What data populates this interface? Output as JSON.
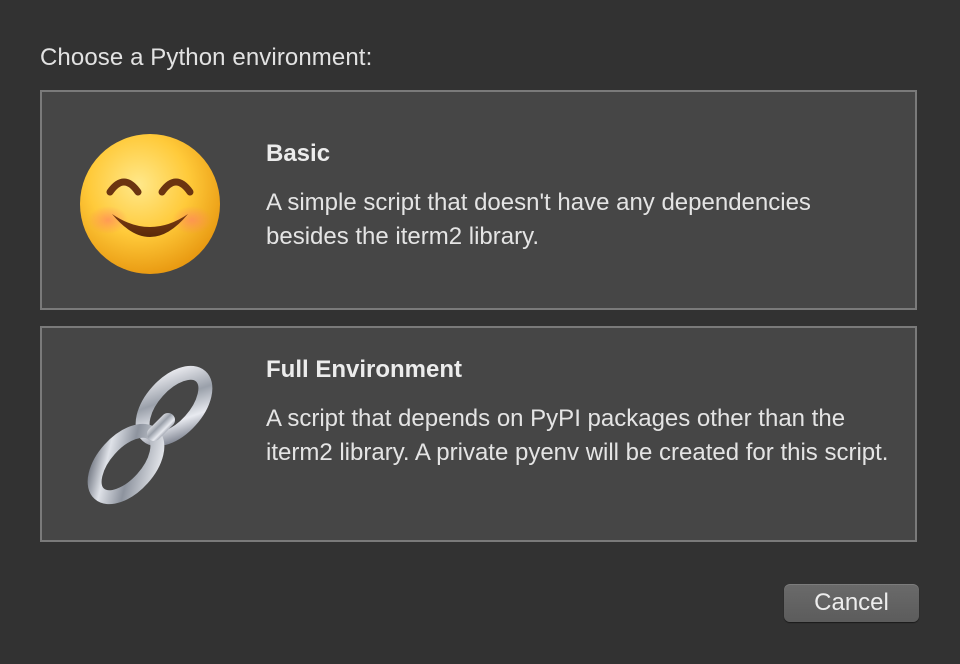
{
  "dialog": {
    "prompt": "Choose a Python environment:",
    "cancel_label": "Cancel"
  },
  "options": [
    {
      "icon": "smiling-face-icon",
      "title": "Basic",
      "description": "A simple script that doesn't have any dependencies besides the iterm2 library."
    },
    {
      "icon": "chain-link-icon",
      "title": "Full Environment",
      "description": "A script that depends on PyPI packages other than the iterm2 library. A private pyenv will be created for this script."
    }
  ],
  "colors": {
    "background": "#323232",
    "panel": "#464646",
    "panel_border": "#7a7a7a",
    "text": "#e6e6e6",
    "button": "#636363"
  }
}
